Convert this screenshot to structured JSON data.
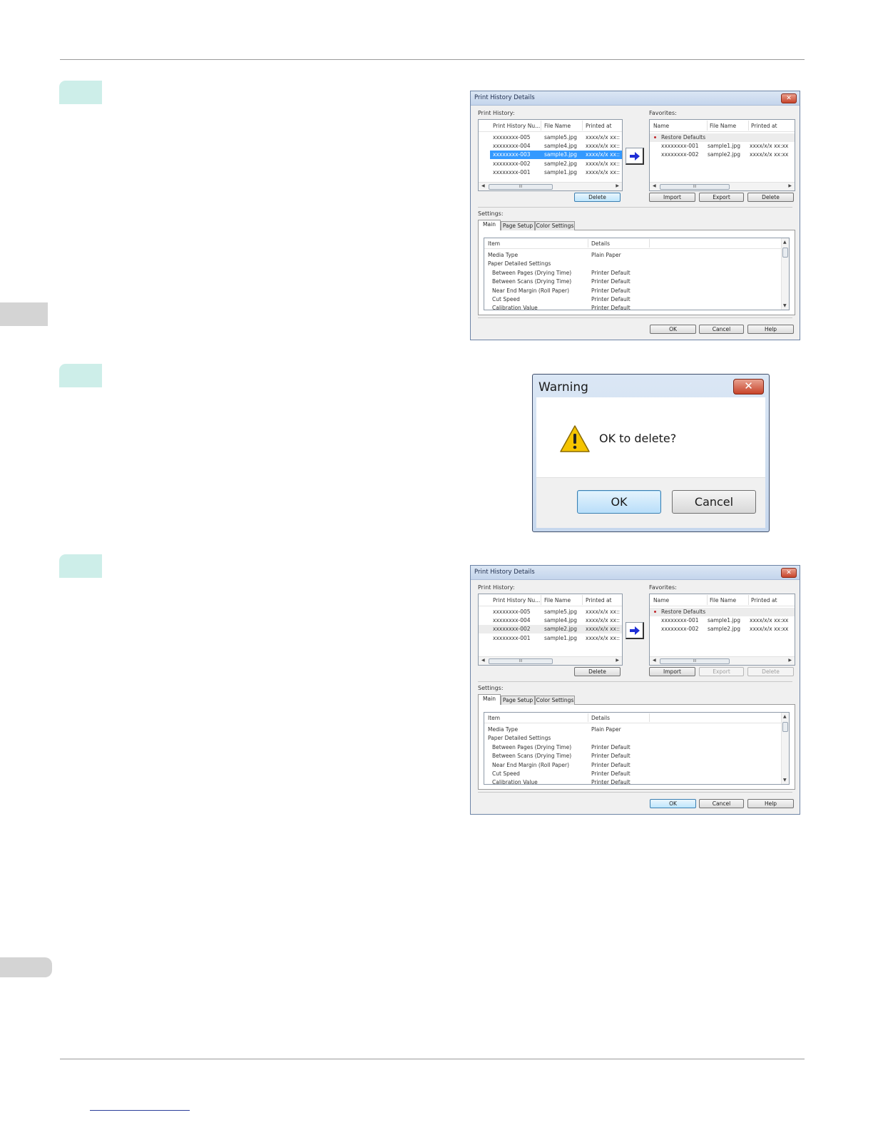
{
  "dialog1": {
    "title": "Print History Details",
    "print_history_label": "Print History:",
    "favorites_label": "Favorites:",
    "history_columns": [
      "Print History Nu...",
      "File Name",
      "Printed at"
    ],
    "history_rows": [
      {
        "num": "xxxxxxxx-005",
        "file": "sample5.jpg",
        "at": "xxxx/x/x xx::"
      },
      {
        "num": "xxxxxxxx-004",
        "file": "sample4.jpg",
        "at": "xxxx/x/x xx::"
      },
      {
        "num": "xxxxxxxx-003",
        "file": "sample3.jpg",
        "at": "xxxx/x/x xx::"
      },
      {
        "num": "xxxxxxxx-002",
        "file": "sample2.jpg",
        "at": "xxxx/x/x xx::"
      },
      {
        "num": "xxxxxxxx-001",
        "file": "sample1.jpg",
        "at": "xxxx/x/x xx::"
      }
    ],
    "favorites_columns": [
      "Name",
      "File Name",
      "Printed at"
    ],
    "favorites_rows": [
      {
        "name": "Restore Defaults",
        "file": "",
        "at": ""
      },
      {
        "name": "xxxxxxxx-001",
        "file": "sample1.jpg",
        "at": "xxxx/x/x xx:xx"
      },
      {
        "name": "xxxxxxxx-002",
        "file": "sample2.jpg",
        "at": "xxxx/x/x xx:xx"
      }
    ],
    "scroll_mark": "III",
    "delete_label": "Delete",
    "import_label": "Import",
    "export_label": "Export",
    "fav_delete_label": "Delete",
    "settings_label": "Settings:",
    "tabs": [
      "Main",
      "Page Setup",
      "Color Settings"
    ],
    "settings_columns": [
      "Item",
      "Details"
    ],
    "settings_rows": [
      {
        "item": "Media Type",
        "detail": "Plain Paper"
      },
      {
        "item": "Paper Detailed Settings",
        "detail": ""
      },
      {
        "item": "Between Pages (Drying Time)",
        "detail": "Printer Default"
      },
      {
        "item": "Between Scans (Drying Time)",
        "detail": "Printer Default"
      },
      {
        "item": "Near End Margin (Roll Paper)",
        "detail": "Printer Default"
      },
      {
        "item": "Cut Speed",
        "detail": "Printer Default"
      },
      {
        "item": "Calibration Value",
        "detail": "Printer Default"
      }
    ],
    "ok_label": "OK",
    "cancel_label": "Cancel",
    "help_label": "Help"
  },
  "warning": {
    "title": "Warning",
    "message": "OK to delete?",
    "ok_label": "OK",
    "cancel_label": "Cancel"
  },
  "dialog3": {
    "title": "Print History Details",
    "print_history_label": "Print History:",
    "favorites_label": "Favorites:",
    "history_columns": [
      "Print History Nu...",
      "File Name",
      "Printed at"
    ],
    "history_rows": [
      {
        "num": "xxxxxxxx-005",
        "file": "sample5.jpg",
        "at": "xxxx/x/x xx::"
      },
      {
        "num": "xxxxxxxx-004",
        "file": "sample4.jpg",
        "at": "xxxx/x/x xx::"
      },
      {
        "num": "xxxxxxxx-002",
        "file": "sample2.jpg",
        "at": "xxxx/x/x xx::"
      },
      {
        "num": "xxxxxxxx-001",
        "file": "sample1.jpg",
        "at": "xxxx/x/x xx::"
      }
    ],
    "favorites_columns": [
      "Name",
      "File Name",
      "Printed at"
    ],
    "favorites_rows": [
      {
        "name": "Restore Defaults",
        "file": "",
        "at": ""
      },
      {
        "name": "xxxxxxxx-001",
        "file": "sample1.jpg",
        "at": "xxxx/x/x xx:xx"
      },
      {
        "name": "xxxxxxxx-002",
        "file": "sample2.jpg",
        "at": "xxxx/x/x xx:xx"
      }
    ],
    "scroll_mark": "III",
    "delete_label": "Delete",
    "import_label": "Import",
    "export_label": "Export",
    "fav_delete_label": "Delete",
    "settings_label": "Settings:",
    "tabs": [
      "Main",
      "Page Setup",
      "Color Settings"
    ],
    "settings_columns": [
      "Item",
      "Details"
    ],
    "settings_rows": [
      {
        "item": "Media Type",
        "detail": "Plain Paper"
      },
      {
        "item": "Paper Detailed Settings",
        "detail": ""
      },
      {
        "item": "Between Pages (Drying Time)",
        "detail": "Printer Default"
      },
      {
        "item": "Between Scans (Drying Time)",
        "detail": "Printer Default"
      },
      {
        "item": "Near End Margin (Roll Paper)",
        "detail": "Printer Default"
      },
      {
        "item": "Cut Speed",
        "detail": "Printer Default"
      },
      {
        "item": "Calibration Value",
        "detail": "Printer Default"
      }
    ],
    "ok_label": "OK",
    "cancel_label": "Cancel",
    "help_label": "Help"
  },
  "colors": {
    "step_marker": "#cdeee9",
    "selection": "#3399ff",
    "accent_arrow": "#1f2fd6"
  },
  "icons": [
    "close-icon",
    "arrow-right-icon",
    "warning-icon",
    "bullet-icon"
  ]
}
